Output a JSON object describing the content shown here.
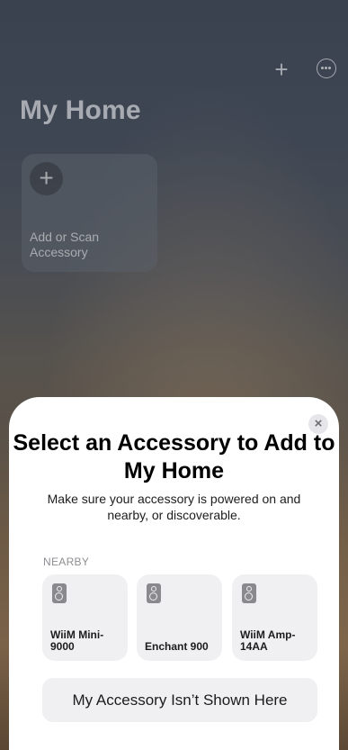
{
  "background": {
    "title": "My Home",
    "add_tile_label": "Add or Scan Accessory",
    "icons": [
      "plus-icon",
      "more-icon"
    ]
  },
  "sheet": {
    "title": "Select an Accessory to Add to My Home",
    "subtitle": "Make sure your accessory is powered on and nearby, or discoverable.",
    "section_label": "NEARBY",
    "accessories": [
      {
        "name": "WiiM Mini-9000",
        "icon": "speaker-icon"
      },
      {
        "name": "Enchant 900",
        "icon": "speaker-icon"
      },
      {
        "name": "WiiM Amp-14AA",
        "icon": "speaker-icon"
      }
    ],
    "not_shown_label": "My Accessory Isn’t Shown Here",
    "close_glyph": "×"
  },
  "colors": {
    "sheet_bg": "#ffffff",
    "card_bg": "#f0f0f3",
    "secondary_text": "#8e8e93"
  }
}
